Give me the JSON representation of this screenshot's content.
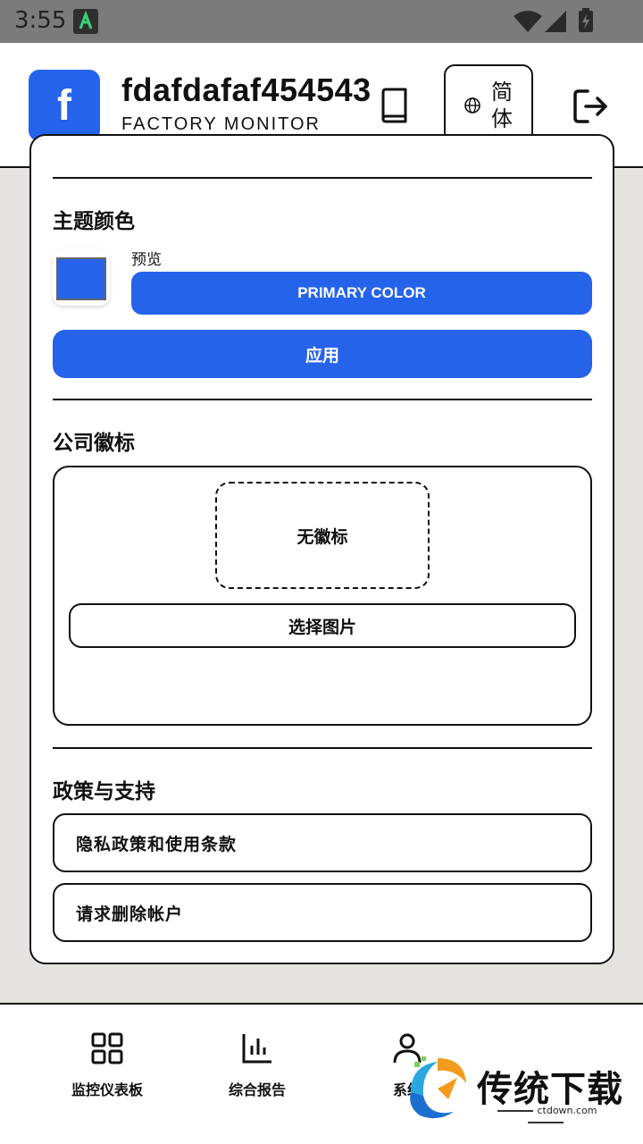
{
  "status_bar": {
    "time": "3:55"
  },
  "header": {
    "logo_letter": "f",
    "app_name": "fdafdafaf454543",
    "subtitle": "FACTORY MONITOR",
    "language_label": "简体",
    "brand_color": "#2563eb"
  },
  "theme": {
    "title": "主题颜色",
    "preview_label": "预览",
    "primary_button": "PRIMARY COLOR",
    "apply_button": "应用",
    "selected_color": "#2563eb"
  },
  "company_logo": {
    "title": "公司徽标",
    "placeholder": "无徽标",
    "choose_button": "选择图片"
  },
  "policy": {
    "title": "政策与支持",
    "items": [
      "隐私政策和使用条款",
      "请求删除帐户"
    ]
  },
  "bottom_nav": {
    "items": [
      {
        "label": "监控仪表板",
        "icon": "grid-icon"
      },
      {
        "label": "综合报告",
        "icon": "bar-chart-icon"
      },
      {
        "label": "系统",
        "icon": "user-icon"
      }
    ]
  },
  "watermark": {
    "text": "传统下载",
    "url": "ctdown.com"
  }
}
